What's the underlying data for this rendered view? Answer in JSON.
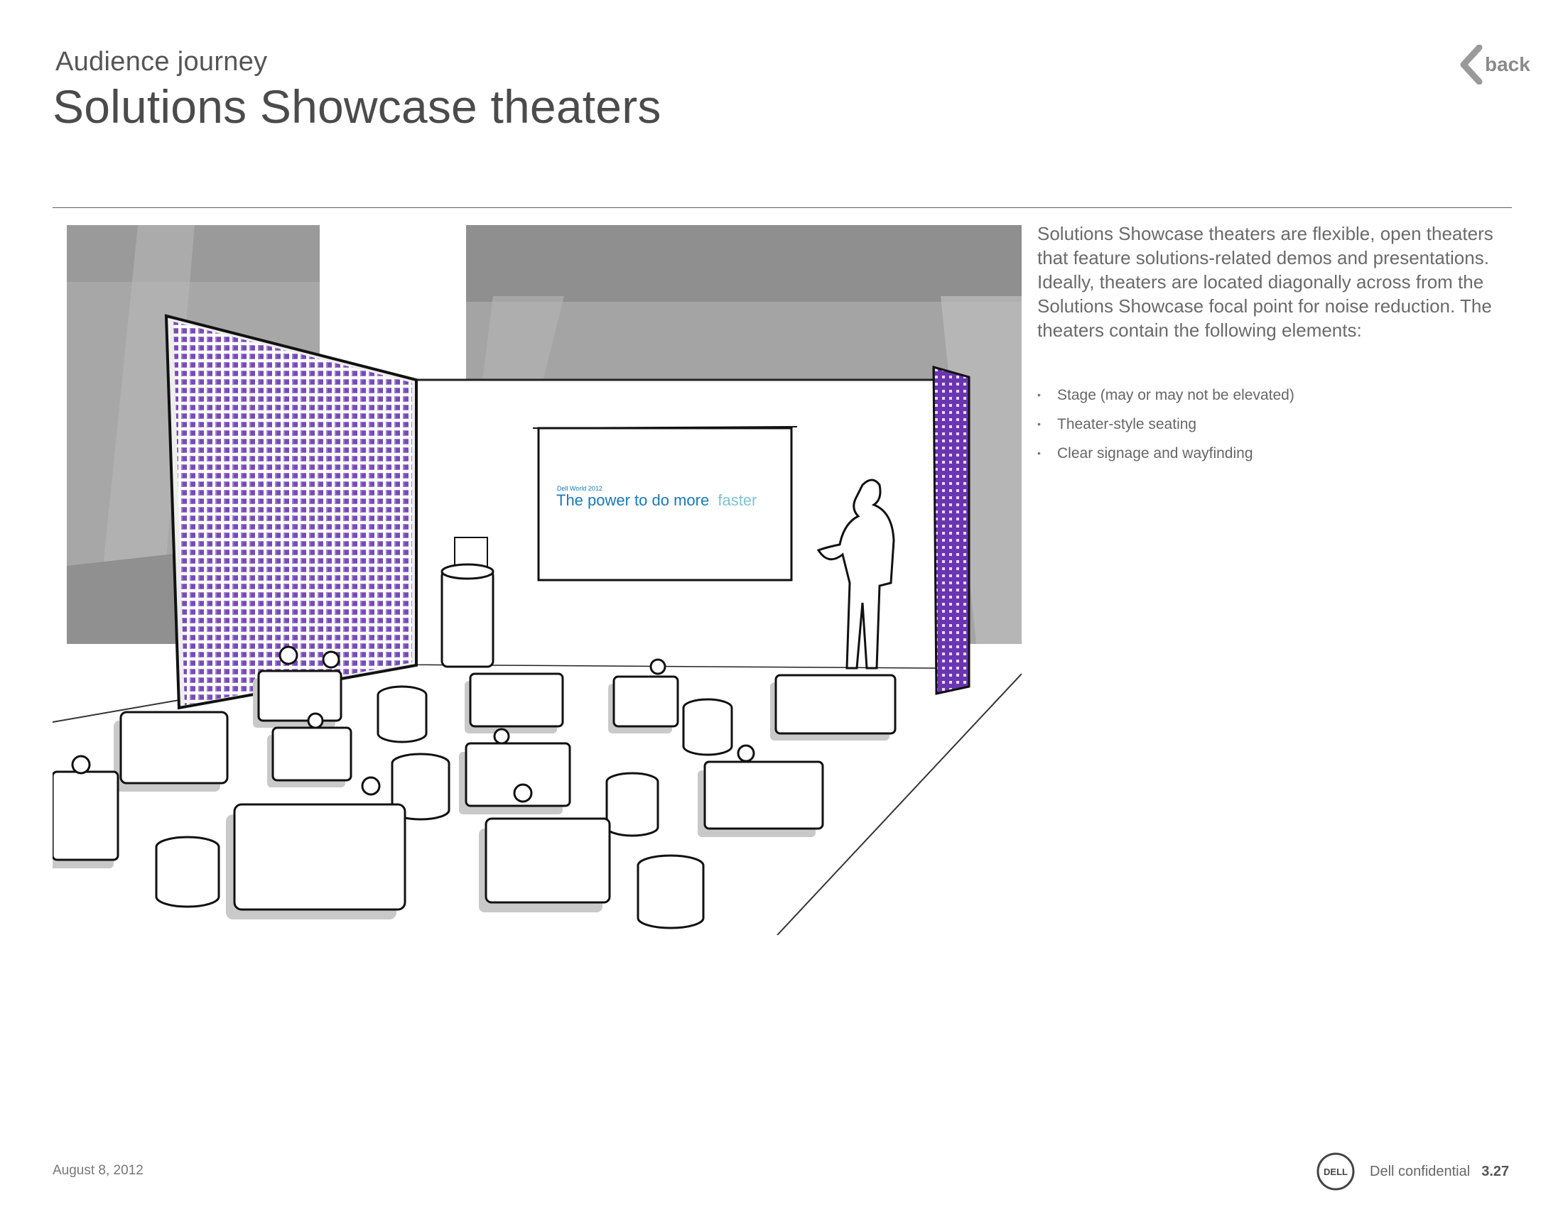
{
  "header": {
    "kicker": "Audience journey",
    "title": "Solutions Showcase theaters",
    "back_label": "back"
  },
  "illustration": {
    "screen_kicker": "Dell World 2012",
    "screen_tagline": "The power to do more",
    "screen_tagline_accent": "faster",
    "colors": {
      "panel_purple": "#6c3fb0",
      "screen_blue": "#1a78b8",
      "screen_accent": "#7ec3d0"
    }
  },
  "content": {
    "paragraph": "Solutions Showcase theaters are flexible, open theaters that feature solutions-related demos and presentations. Ideally, theaters are located diagonally across from the Solutions Showcase focal point for noise reduction. The theaters contain the following elements:",
    "bullets": [
      "Stage (may or may not be elevated)",
      "Theater-style seating",
      "Clear signage and wayfinding"
    ]
  },
  "footer": {
    "date": "August 8, 2012",
    "brand": "DELL",
    "confidential": "Dell confidential",
    "page": "3.27"
  }
}
